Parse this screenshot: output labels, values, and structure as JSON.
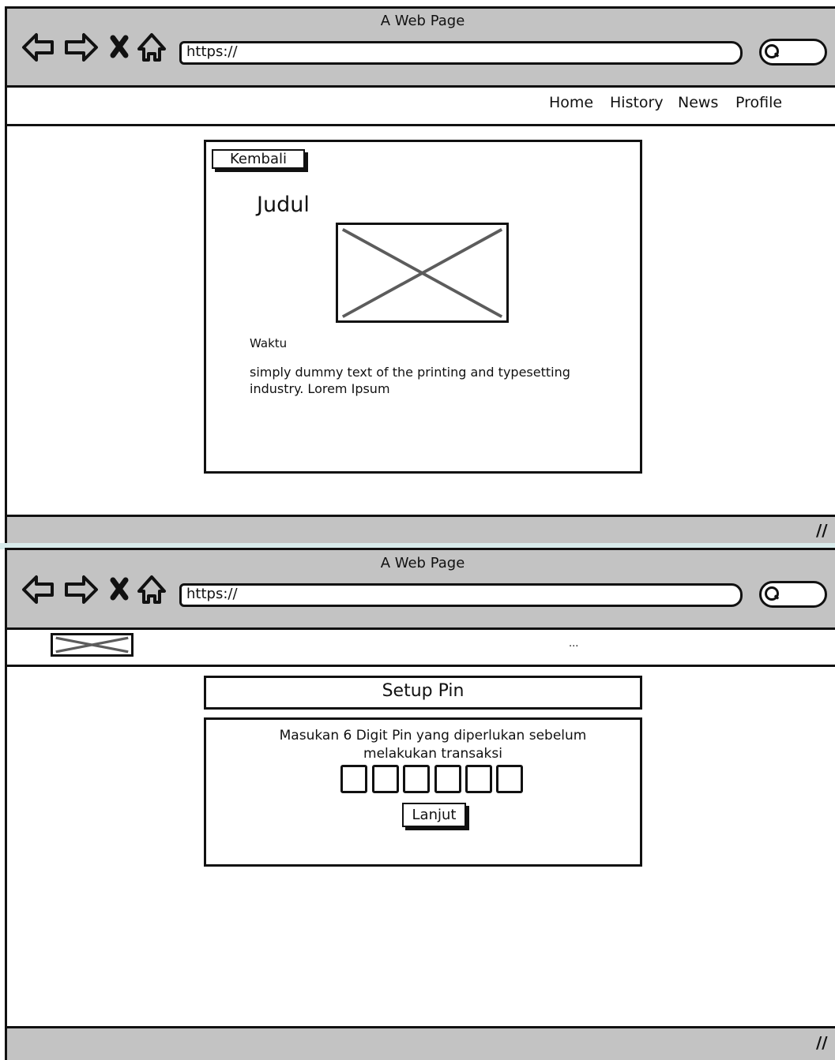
{
  "window1": {
    "title": "A Web Page",
    "url": "https://",
    "nav": {
      "home": "Home",
      "history": "History",
      "news": "News",
      "profile": "Profile"
    },
    "back_button_label": "Kembali",
    "heading": "Judul",
    "time_label": "Waktu",
    "body_text_line1": "simply dummy text of the printing and typesetting",
    "body_text_line2": "industry. Lorem Ipsum"
  },
  "window2": {
    "title": "A Web Page",
    "url": "https://",
    "menu_ellipsis": "...",
    "setup_title": "Setup Pin",
    "instruction_line1": "Masukan 6 Digit Pin yang diperlukan sebelum",
    "instruction_line2": "melakukan transaksi",
    "pin_count": 6,
    "continue_label": "Lanjut"
  },
  "colors": {
    "chrome": "#c3c3c3",
    "stroke": "#111111",
    "placeholder_x": "#5c5c5c"
  },
  "icons": [
    "back-arrow-icon",
    "forward-arrow-icon",
    "close-icon",
    "home-icon",
    "search-icon",
    "resize-grip-icon",
    "image-placeholder-icon"
  ]
}
